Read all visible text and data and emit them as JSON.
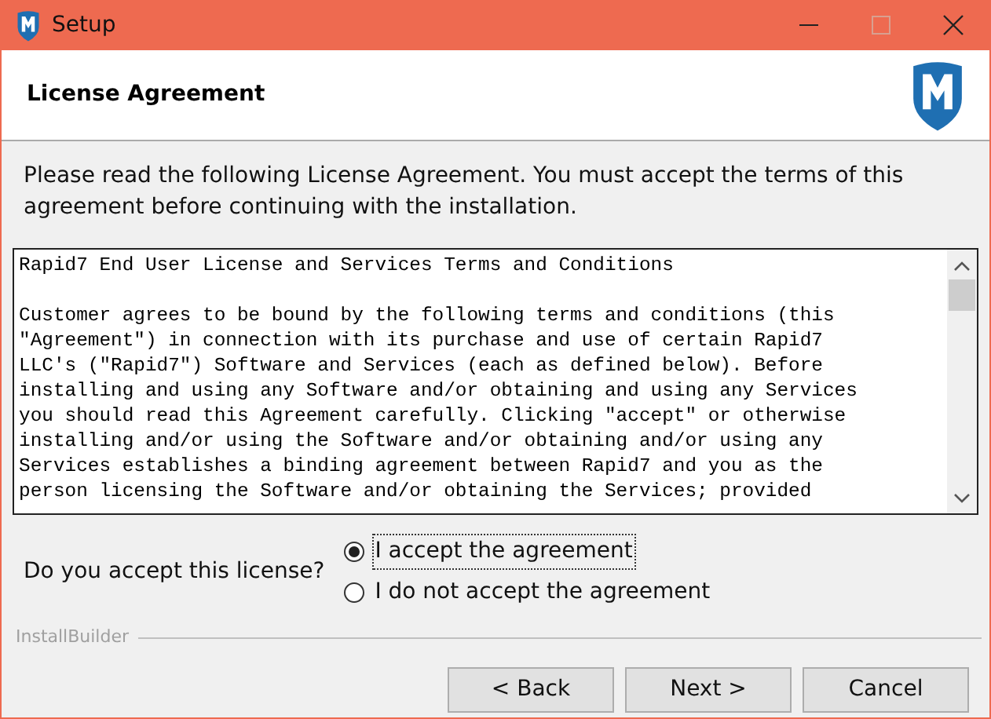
{
  "window": {
    "title": "Setup"
  },
  "header": {
    "title": "License Agreement"
  },
  "intro": "Please read the following License Agreement. You must accept the terms of this agreement before continuing with the installation.",
  "license_heading": "Rapid7 End User License and Services Terms and Conditions",
  "license_lines": [
    "Customer agrees to be bound by the following terms and conditions (this",
    "\"Agreement\") in connection with its purchase and use of certain Rapid7",
    "LLC's (\"Rapid7\") Software and Services (each as defined below). Before",
    "installing and using any Software and/or obtaining and using any Services",
    "you should read this Agreement carefully. Clicking \"accept\" or otherwise",
    "installing and/or using the Software and/or obtaining and/or using any",
    "Services establishes a binding agreement between Rapid7 and you as the",
    "person licensing the Software and/or obtaining the Services; provided"
  ],
  "question": "Do you accept this license?",
  "options": [
    {
      "label": "I accept the agreement",
      "selected": true
    },
    {
      "label": "I do not accept the agreement",
      "selected": false
    }
  ],
  "brand": "InstallBuilder",
  "buttons": [
    "< Back",
    "Next >",
    "Cancel"
  ]
}
